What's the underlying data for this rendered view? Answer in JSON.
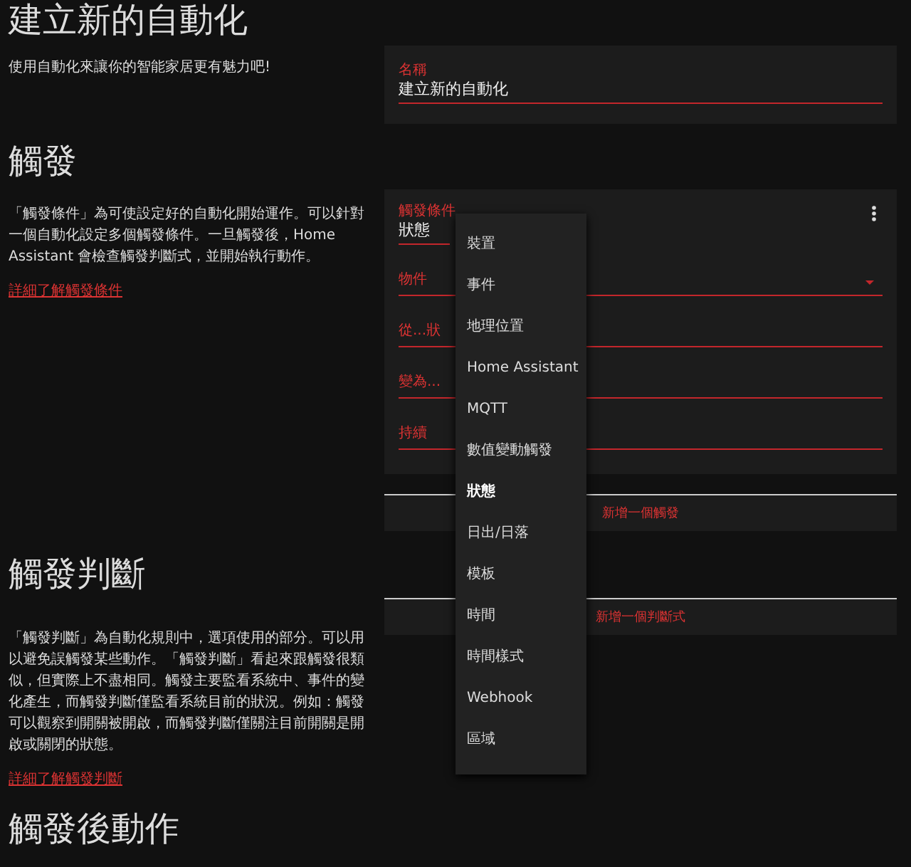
{
  "header": {
    "title": "建立新的自動化",
    "description": "使用自動化來讓你的智能家居更有魅力吧!"
  },
  "name_card": {
    "label": "名稱",
    "value": "建立新的自動化"
  },
  "sections": [
    {
      "title": "觸發",
      "description": "「觸發條件」為可使設定好的自動化開始運作。可以針對一個自動化設定多個觸發條件。一旦觸發後，Home Assistant 會檢查觸發判斷式，並開始執行動作。",
      "link": "詳細了解觸發條件"
    },
    {
      "title": "觸發判斷",
      "description": "「觸發判斷」為自動化規則中，選項使用的部分。可以用以避免誤觸發某些動作。「觸發判斷」看起來跟觸發很類似，但實際上不盡相同。觸發主要監看系統中、事件的變化產生，而觸發判斷僅監看系統目前的狀況。例如：觸發可以觀察到開關被開啟，而觸發判斷僅關注目前開關是開啟或關閉的狀態。",
      "link": "詳細了解觸發判斷"
    },
    {
      "title": "觸發後動作"
    }
  ],
  "trigger_card": {
    "type_field": {
      "label": "觸發條件",
      "value": "狀態"
    },
    "fields": [
      {
        "label": "物件",
        "kind": "dropdown"
      },
      {
        "label": "從...狀",
        "kind": "text"
      },
      {
        "label": "變為...",
        "kind": "text"
      },
      {
        "label": "持續",
        "kind": "text"
      }
    ],
    "add_button": "新增一個觸發"
  },
  "condition_card": {
    "add_button": "新增一個判斷式"
  },
  "trigger_menu": [
    {
      "label": "裝置",
      "selected": false
    },
    {
      "label": "事件",
      "selected": false
    },
    {
      "label": "地理位置",
      "selected": false
    },
    {
      "label": "Home Assistant",
      "selected": false
    },
    {
      "label": "MQTT",
      "selected": false
    },
    {
      "label": "數值變動觸發",
      "selected": false
    },
    {
      "label": "狀態",
      "selected": true
    },
    {
      "label": "日出/日落",
      "selected": false
    },
    {
      "label": "模板",
      "selected": false
    },
    {
      "label": "時間",
      "selected": false
    },
    {
      "label": "時間樣式",
      "selected": false
    },
    {
      "label": "Webhook",
      "selected": false
    },
    {
      "label": "區域",
      "selected": false
    }
  ]
}
